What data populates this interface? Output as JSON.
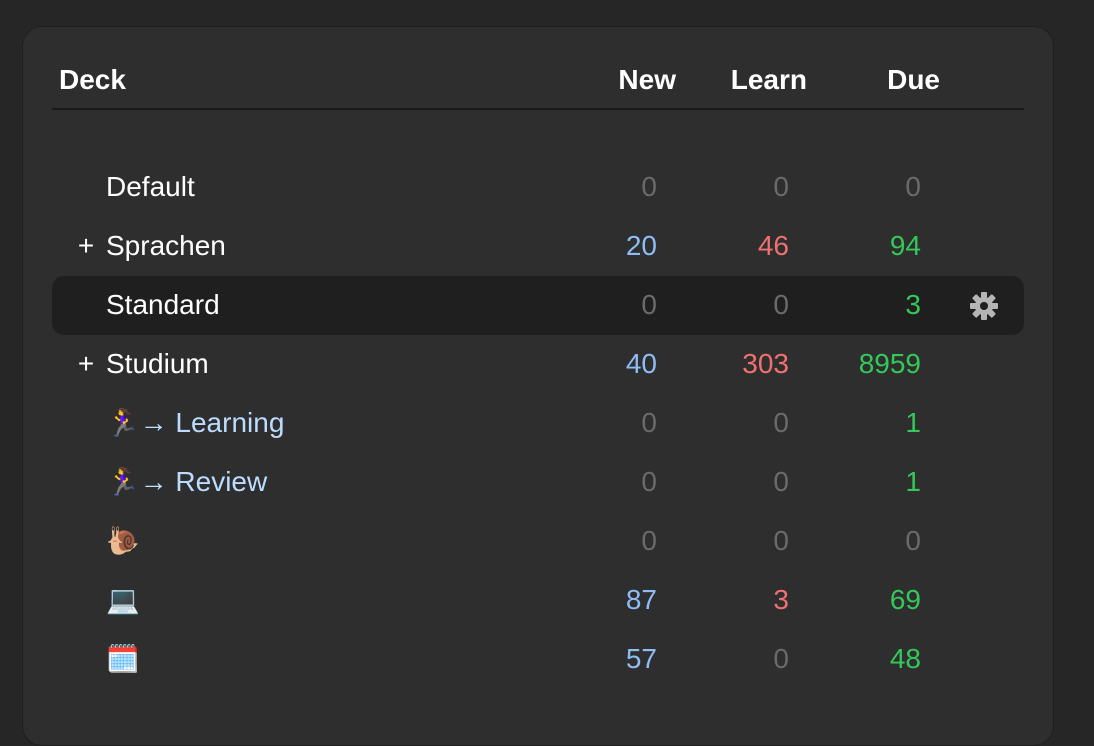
{
  "header": {
    "deck": "Deck",
    "new": "New",
    "learn": "Learn",
    "due": "Due"
  },
  "decks": [
    {
      "expander": "",
      "name": "Default",
      "new": "0",
      "learn": "0",
      "due": "0"
    },
    {
      "expander": "+",
      "name": "Sprachen",
      "new": "20",
      "learn": "46",
      "due": "94"
    },
    {
      "expander": "",
      "name": "Standard",
      "new": "0",
      "learn": "0",
      "due": "3",
      "selected": true
    },
    {
      "expander": "+",
      "name": "Studium",
      "new": "40",
      "learn": "303",
      "due": "8959"
    },
    {
      "expander": "",
      "emoji": "🏃‍♀️",
      "arrow": "→",
      "name": "Learning",
      "new": "0",
      "learn": "0",
      "due": "1"
    },
    {
      "expander": "",
      "emoji": "🏃‍♀️",
      "arrow": "→",
      "name": "Review",
      "new": "0",
      "learn": "0",
      "due": "1"
    },
    {
      "expander": "",
      "emoji": "🐌",
      "name": "",
      "new": "0",
      "learn": "0",
      "due": "0"
    },
    {
      "expander": "",
      "emoji": "💻",
      "name": "",
      "new": "87",
      "learn": "3",
      "due": "69"
    },
    {
      "expander": "",
      "emoji": "🗓️",
      "name": "",
      "new": "57",
      "learn": "0",
      "due": "48"
    }
  ],
  "icons": {
    "options": "gear-icon"
  },
  "colors": {
    "new": "#8ebdf5",
    "learn": "#f07070",
    "due": "#34c759",
    "zero": "#6a6a6a"
  }
}
